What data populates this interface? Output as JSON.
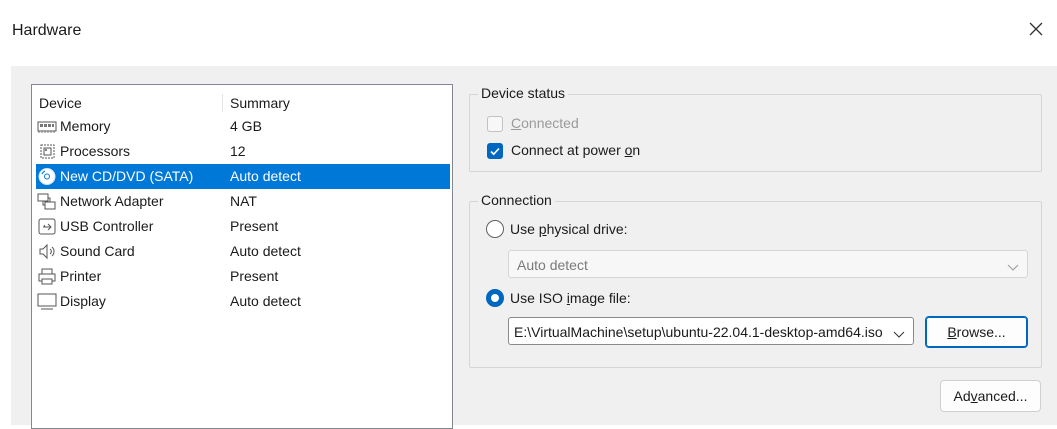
{
  "window": {
    "title": "Hardware"
  },
  "device_list": {
    "columns": [
      "Device",
      "Summary"
    ],
    "rows": [
      {
        "name": "Memory",
        "summary": "4 GB",
        "icon": "memory-icon"
      },
      {
        "name": "Processors",
        "summary": "12",
        "icon": "processor-icon"
      },
      {
        "name": "New CD/DVD (SATA)",
        "summary": "Auto detect",
        "icon": "cd-dvd-icon",
        "selected": true
      },
      {
        "name": "Network Adapter",
        "summary": "NAT",
        "icon": "network-icon"
      },
      {
        "name": "USB Controller",
        "summary": "Present",
        "icon": "usb-icon"
      },
      {
        "name": "Sound Card",
        "summary": "Auto detect",
        "icon": "speaker-icon"
      },
      {
        "name": "Printer",
        "summary": "Present",
        "icon": "printer-icon"
      },
      {
        "name": "Display",
        "summary": "Auto detect",
        "icon": "display-icon"
      }
    ]
  },
  "device_status": {
    "legend": "Device status",
    "connected": {
      "label": "Connected",
      "checked": false,
      "enabled": false
    },
    "connect_at_power_on": {
      "label": "Connect at power on",
      "checked": true
    }
  },
  "connection": {
    "legend": "Connection",
    "physical_drive": {
      "label": "Use physical drive:",
      "selected": false,
      "value": "Auto detect"
    },
    "iso_image": {
      "label": "Use ISO image file:",
      "selected": true,
      "path": "E:\\VirtualMachine\\setup\\ubuntu-22.04.1-desktop-amd64.iso"
    },
    "browse_label": "Browse..."
  },
  "advanced_label": "Advanced...",
  "colors": {
    "selection": "#0078d7",
    "accent": "#0067c0",
    "panel": "#f0f0f0"
  }
}
